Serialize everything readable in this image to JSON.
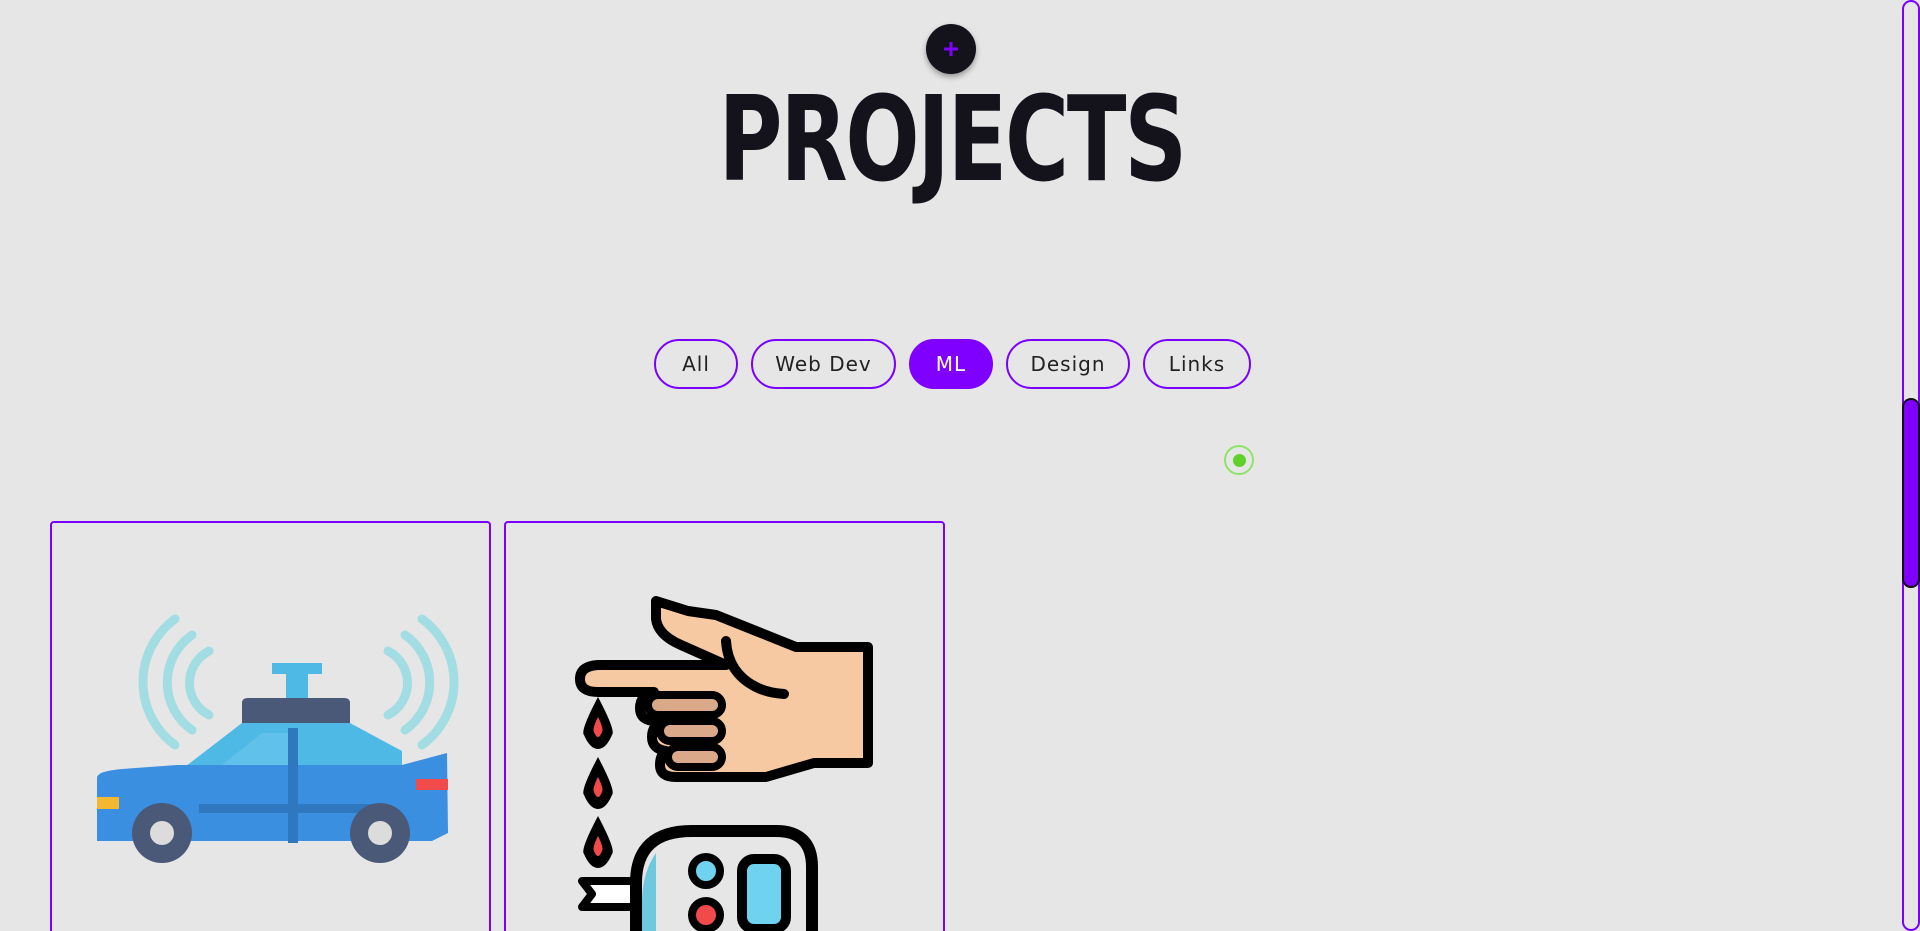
{
  "header": {
    "title": "PROJECTS",
    "fab_icon": "plus-icon"
  },
  "filters": {
    "items": [
      {
        "label": "All",
        "active": false
      },
      {
        "label": "Web Dev",
        "active": false
      },
      {
        "label": "ML",
        "active": true
      },
      {
        "label": "Design",
        "active": false
      },
      {
        "label": "Links",
        "active": false
      }
    ]
  },
  "status": {
    "color": "#5fd22a"
  },
  "projects": [
    {
      "icon": "self-driving-car-icon"
    },
    {
      "icon": "blood-glucose-test-icon"
    }
  ],
  "colors": {
    "accent": "#8000ff",
    "background": "#e6e6e6",
    "title": "#14131c"
  }
}
